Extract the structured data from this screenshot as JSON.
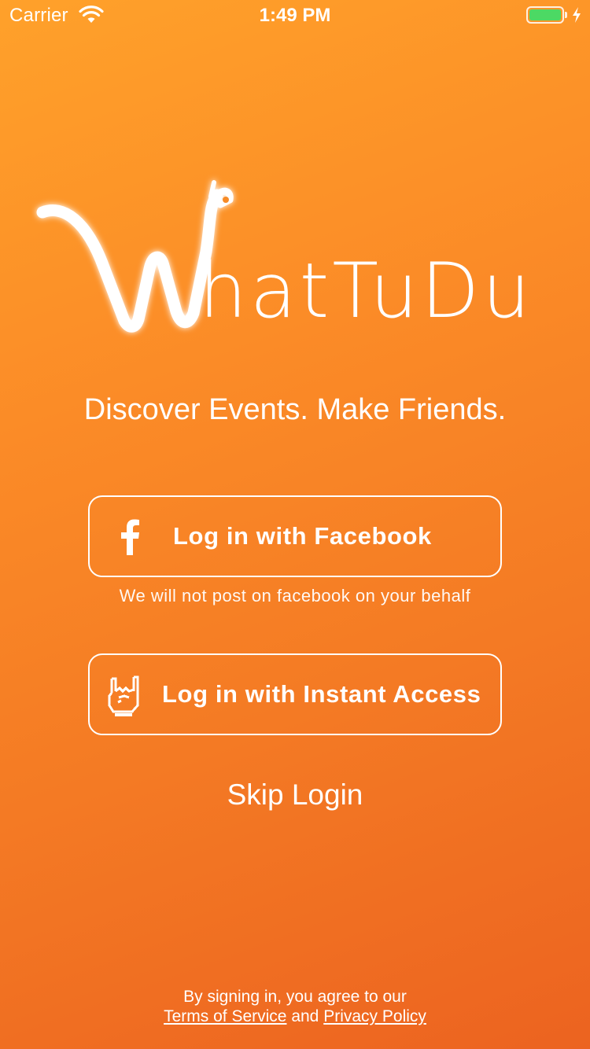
{
  "status_bar": {
    "carrier": "Carrier",
    "time": "1:49 PM",
    "battery_level": 1.0,
    "battery_color": "#4cd964",
    "icons": [
      "wifi-icon",
      "battery-icon",
      "charging-bolt-icon"
    ]
  },
  "brand": {
    "logo_text": "hatTuDu",
    "logo_mark": "W-llama-icon"
  },
  "tagline": "Discover Events. Make Friends.",
  "facebook_button": {
    "label": "Log in with Facebook",
    "icon": "facebook-f-icon"
  },
  "facebook_note": "We will not post on facebook on your behalf",
  "instant_button": {
    "label": "Log in with Instant Access",
    "icon": "rock-hand-icon"
  },
  "skip_label": "Skip Login",
  "legal": {
    "line1": "By signing in, you agree to our",
    "terms_link": "Terms of Service",
    "and": "and",
    "privacy_link": "Privacy Policy"
  },
  "colors": {
    "background_start": "#ffa12a",
    "background_end": "#ec6320",
    "foreground": "#ffffff"
  }
}
